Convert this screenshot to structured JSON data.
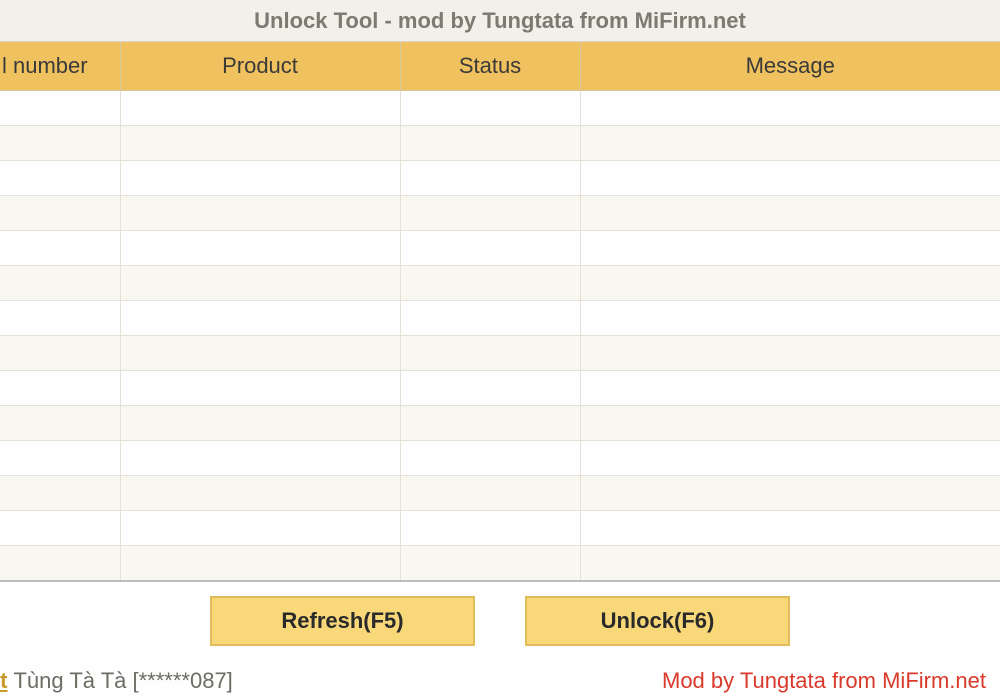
{
  "window": {
    "title": "Unlock Tool - mod by Tungtata from MiFirm.net"
  },
  "table": {
    "columns": {
      "serial": "l number",
      "product": "Product",
      "status": "Status",
      "message": "Message"
    },
    "rows": [
      {
        "serial": "",
        "product": "",
        "status": "",
        "message": ""
      },
      {
        "serial": "",
        "product": "",
        "status": "",
        "message": ""
      },
      {
        "serial": "",
        "product": "",
        "status": "",
        "message": ""
      },
      {
        "serial": "",
        "product": "",
        "status": "",
        "message": ""
      },
      {
        "serial": "",
        "product": "",
        "status": "",
        "message": ""
      },
      {
        "serial": "",
        "product": "",
        "status": "",
        "message": ""
      },
      {
        "serial": "",
        "product": "",
        "status": "",
        "message": ""
      },
      {
        "serial": "",
        "product": "",
        "status": "",
        "message": ""
      },
      {
        "serial": "",
        "product": "",
        "status": "",
        "message": ""
      },
      {
        "serial": "",
        "product": "",
        "status": "",
        "message": ""
      },
      {
        "serial": "",
        "product": "",
        "status": "",
        "message": ""
      },
      {
        "serial": "",
        "product": "",
        "status": "",
        "message": ""
      },
      {
        "serial": "",
        "product": "",
        "status": "",
        "message": ""
      },
      {
        "serial": "",
        "product": "",
        "status": "",
        "message": ""
      }
    ]
  },
  "buttons": {
    "refresh": "Refresh(F5)",
    "unlock": "Unlock(F6)"
  },
  "footer": {
    "logout_link": "it",
    "user_display": "Tùng Tà Tà [******087]",
    "mod_credit": "Mod by Tungtata from MiFirm.net"
  }
}
